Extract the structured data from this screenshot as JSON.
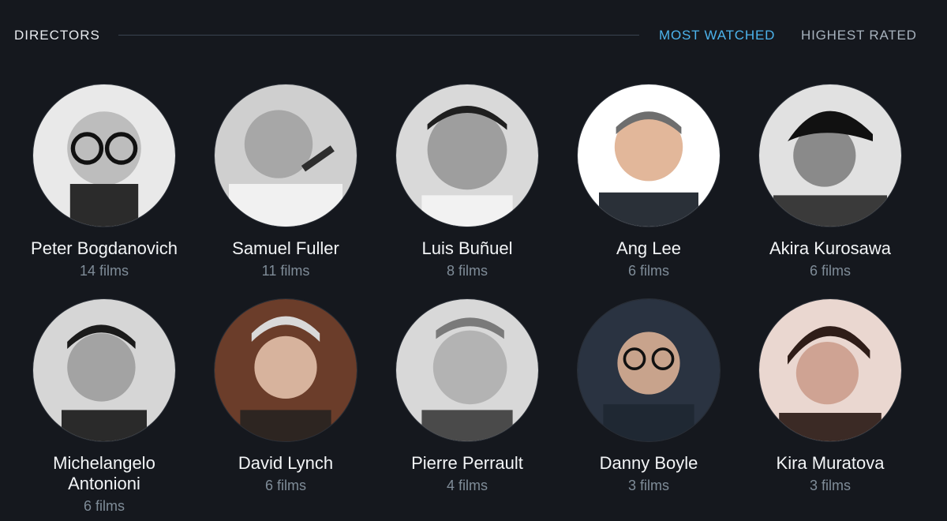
{
  "header": {
    "title": "DIRECTORS",
    "tabs": [
      {
        "label": "MOST WATCHED",
        "active": true
      },
      {
        "label": "HIGHEST RATED",
        "active": false
      }
    ],
    "colors": {
      "active": "#4cb3ec",
      "inactive": "#a7b2bd"
    }
  },
  "directors": [
    {
      "name": "Peter Bogdanovich",
      "films": "14 films",
      "photo": "portrait-bw"
    },
    {
      "name": "Samuel Fuller",
      "films": "11 films",
      "photo": "portrait-bw"
    },
    {
      "name": "Luis Buñuel",
      "films": "8 films",
      "photo": "portrait-bw"
    },
    {
      "name": "Ang Lee",
      "films": "6 films",
      "photo": "portrait-color"
    },
    {
      "name": "Akira Kurosawa",
      "films": "6 films",
      "photo": "portrait-bw"
    },
    {
      "name": "Michelangelo Antonioni",
      "films": "6 films",
      "photo": "portrait-bw"
    },
    {
      "name": "David Lynch",
      "films": "6 films",
      "photo": "portrait-color"
    },
    {
      "name": "Pierre Perrault",
      "films": "4 films",
      "photo": "portrait-bw"
    },
    {
      "name": "Danny Boyle",
      "films": "3 films",
      "photo": "portrait-color"
    },
    {
      "name": "Kira Muratova",
      "films": "3 films",
      "photo": "portrait-sepia"
    }
  ]
}
